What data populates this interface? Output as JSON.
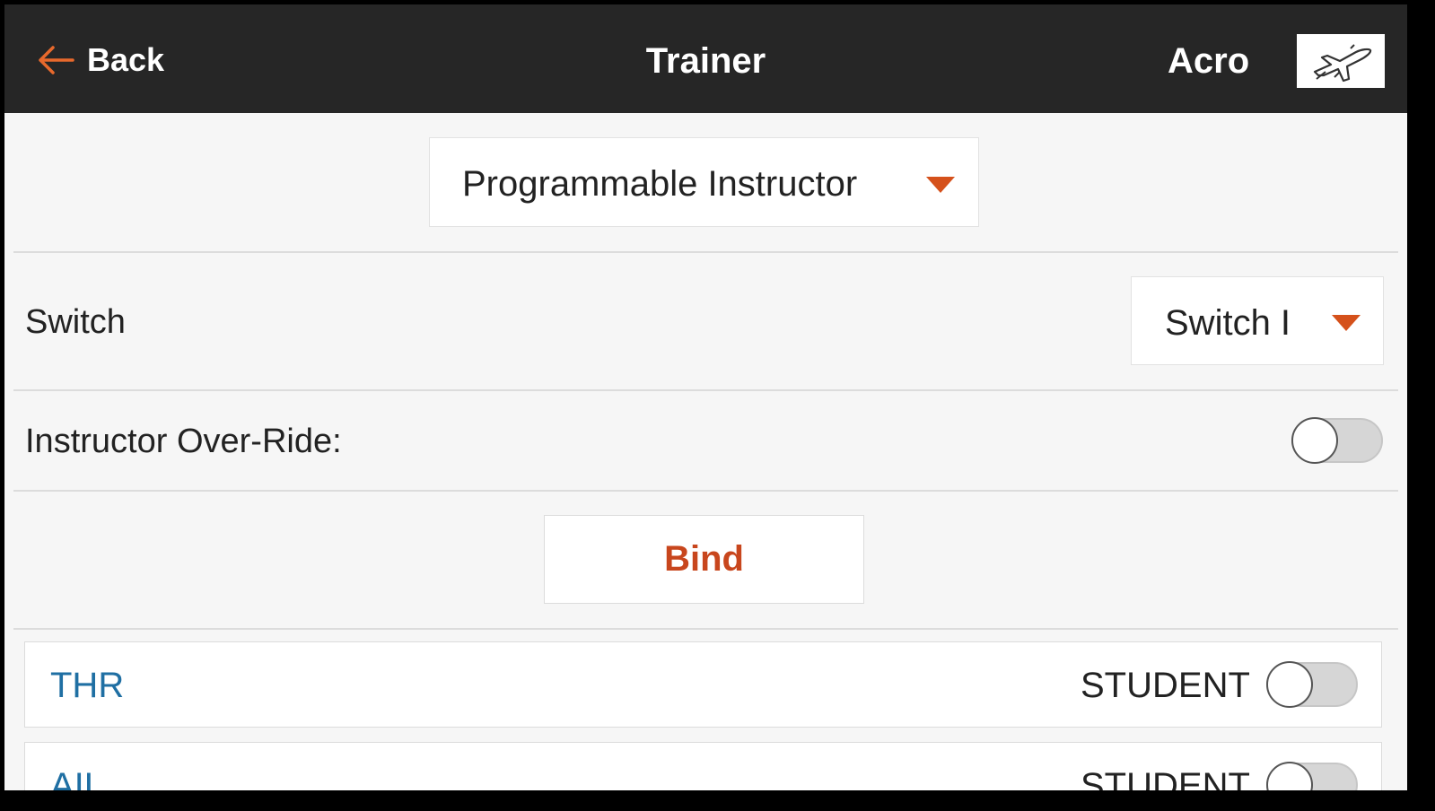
{
  "header": {
    "back_label": "Back",
    "title": "Trainer",
    "model_name": "Acro",
    "model_icon": "airplane-icon"
  },
  "mode_dropdown": {
    "value": "Programmable Instructor"
  },
  "switch_row": {
    "label": "Switch",
    "value": "Switch I"
  },
  "override_row": {
    "label": "Instructor Over-Ride:",
    "enabled": false
  },
  "bind_button": {
    "label": "Bind"
  },
  "channels": [
    {
      "name": "THR",
      "mode": "STUDENT",
      "enabled": false
    },
    {
      "name": "AIL",
      "mode": "STUDENT",
      "enabled": false
    }
  ],
  "colors": {
    "accent": "#d5511b",
    "channel_text": "#1f6fa3",
    "header_bg": "#262626"
  }
}
